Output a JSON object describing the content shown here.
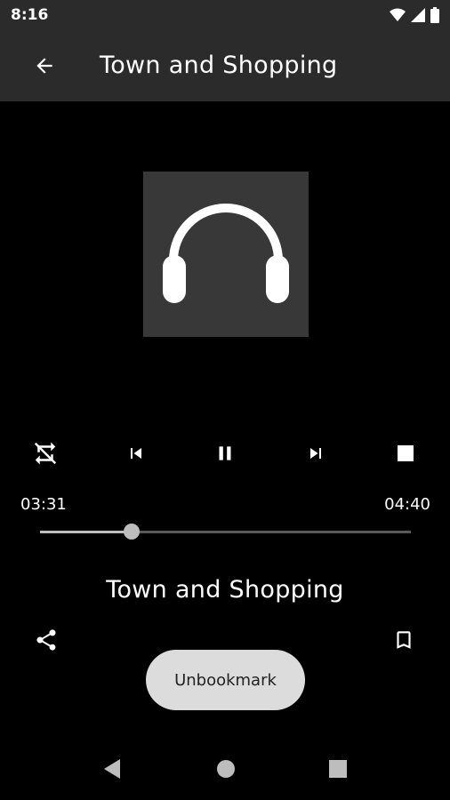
{
  "status_bar": {
    "time": "8:16",
    "icons": [
      "wifi-icon",
      "signal-icon",
      "battery-icon"
    ]
  },
  "app_bar": {
    "back_icon": "arrow-back-icon",
    "title": "Town and Shopping"
  },
  "artwork": {
    "icon": "headphones-icon",
    "background": "#383838"
  },
  "controls": {
    "icons": [
      "shuffle-off-icon",
      "skip-previous-icon",
      "pause-icon",
      "skip-next-icon",
      "stop-icon"
    ]
  },
  "playback": {
    "elapsed": "03:31",
    "duration": "04:40",
    "progress": 0.248
  },
  "track": {
    "title": "Town and Shopping"
  },
  "actions": {
    "share_icon": "share-icon",
    "bookmark_icon": "bookmark-icon"
  },
  "toast": {
    "message": "Unbookmark"
  },
  "nav_bar": {
    "icons": [
      "nav-back-icon",
      "nav-home-icon",
      "nav-recents-icon"
    ]
  },
  "colors": {
    "bar_bg": "#2b2b2b",
    "screen_bg": "#000000",
    "accent": "#ffffff",
    "toast_bg": "#dcdcdc"
  }
}
